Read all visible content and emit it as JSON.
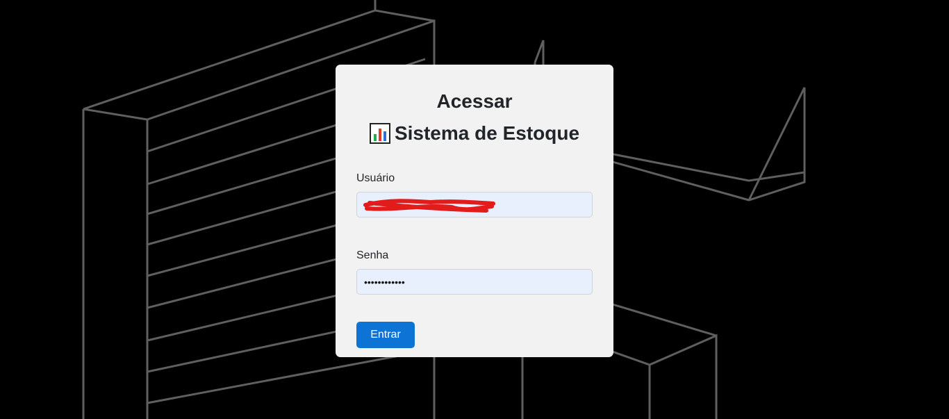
{
  "login": {
    "title": "Acessar",
    "subtitle": "Sistema de Estoque",
    "subtitle_icon": "bar-chart-icon",
    "username_label": "Usuário",
    "username_value": "",
    "password_label": "Senha",
    "password_value": "••••••••••••",
    "submit_label": "Entrar"
  },
  "colors": {
    "page_background": "#000000",
    "card_background": "#f2f2f2",
    "input_background": "#e8f0fe",
    "button_background": "#0d74d6",
    "redaction": "#e21b1b"
  }
}
